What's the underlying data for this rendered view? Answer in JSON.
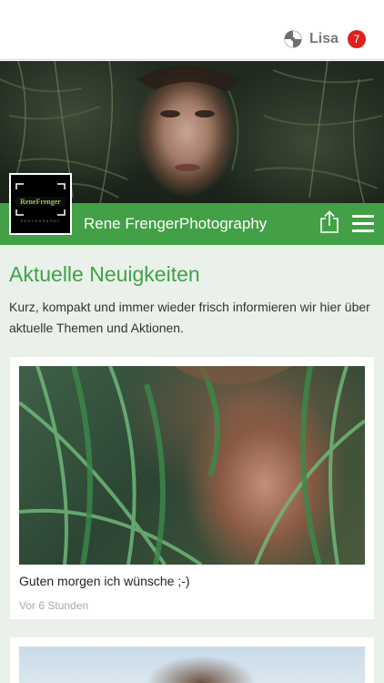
{
  "header": {
    "user_name": "Lisa",
    "notification_count": "7",
    "user_icon": "pinwheel-logo-icon"
  },
  "brand": {
    "title": "Rene FrengerPhotography",
    "logo_text": "ReneFrenger",
    "logo_subtext": "PHOTOGRAPHY",
    "accent_color": "#43a047"
  },
  "section": {
    "title": "Aktuelle Neuigkeiten",
    "description": "Kurz, kompakt und immer wieder frisch informieren wir hier über aktuelle Themen und Aktionen."
  },
  "posts": [
    {
      "caption": "Guten morgen ich wünsche ;-)",
      "time": "Vor 6 Stunden"
    },
    {
      "caption": "",
      "time": ""
    }
  ]
}
